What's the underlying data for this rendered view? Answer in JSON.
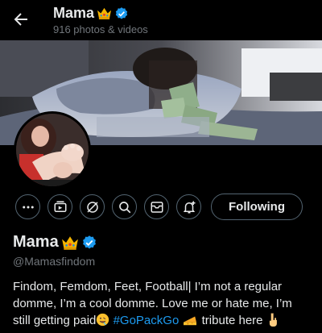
{
  "header": {
    "name": "Mama",
    "subtitle": "916 photos & videos"
  },
  "profile": {
    "display_name": "Mama",
    "handle": "@Mamasfindom",
    "bio_part1": "Findom, Femdom, Feet, Football| I’m not a regular domme, I’m a cool domme. Love me or hate me, I’m still getting paid",
    "hashtag": "#GoPackGo",
    "bio_part2": "tribute here"
  },
  "actions": {
    "following_label": "Following"
  },
  "icons": {
    "back": "arrow-left-icon",
    "crown": "crown-emoji-icon",
    "verified": "verified-badge-icon",
    "more": "more-dots-icon",
    "subscriptions": "subscriptions-icon",
    "grok": "grok-icon",
    "search": "search-icon",
    "message": "message-icon",
    "notify": "notification-bell-icon"
  },
  "colors": {
    "background": "#000000",
    "accent": "#1d9bf0",
    "muted": "#71767b",
    "border": "#536471",
    "crown": "#f4b400"
  }
}
